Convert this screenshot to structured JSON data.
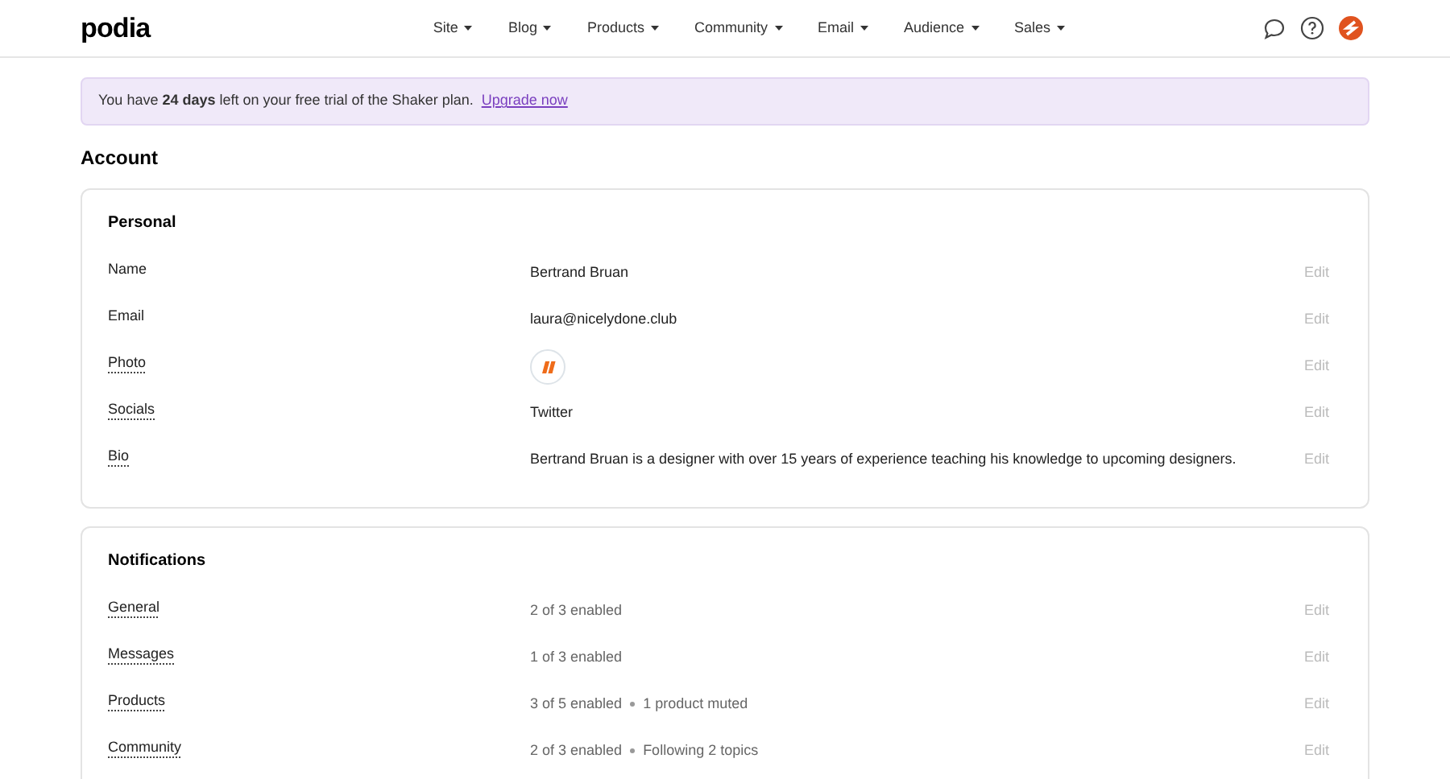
{
  "logo": "podia",
  "nav": [
    {
      "label": "Site"
    },
    {
      "label": "Blog"
    },
    {
      "label": "Products"
    },
    {
      "label": "Community"
    },
    {
      "label": "Email"
    },
    {
      "label": "Audience"
    },
    {
      "label": "Sales"
    }
  ],
  "banner": {
    "text": "You have **24 days** left on your free trial of the Shaker plan.",
    "link": "Upgrade now"
  },
  "page_title": "Account",
  "sections": [
    {
      "title": "Personal",
      "rows": [
        {
          "label": "Name",
          "dotted": false,
          "kind": "text",
          "value": [
            "Bertrand Bruan"
          ],
          "action": "Edit"
        },
        {
          "label": "Email",
          "dotted": false,
          "kind": "text",
          "value": [
            "laura@nicelydone.club"
          ],
          "action": "Edit"
        },
        {
          "label": "Photo",
          "dotted": true,
          "kind": "photo",
          "action": "Edit"
        },
        {
          "label": "Socials",
          "dotted": true,
          "kind": "text",
          "value": [
            "Twitter"
          ],
          "action": "Edit"
        },
        {
          "label": "Bio",
          "dotted": true,
          "kind": "text",
          "value": [
            "Bertrand Bruan is a designer with over 15 years of experience teaching his knowledge to upcoming designers."
          ],
          "action": "Edit"
        }
      ]
    },
    {
      "title": "Notifications",
      "rows": [
        {
          "label": "General",
          "dotted": true,
          "kind": "summary",
          "value": [
            "2 of 3 enabled"
          ],
          "action": "Edit"
        },
        {
          "label": "Messages",
          "dotted": true,
          "kind": "summary",
          "value": [
            "1 of 3 enabled"
          ],
          "action": "Edit"
        },
        {
          "label": "Products",
          "dotted": true,
          "kind": "summary",
          "value": [
            "3 of 5 enabled",
            "1 product muted"
          ],
          "action": "Edit"
        },
        {
          "label": "Community",
          "dotted": true,
          "kind": "summary",
          "value": [
            "2 of 3 enabled",
            "Following 2 topics"
          ],
          "action": "Edit"
        }
      ]
    }
  ]
}
